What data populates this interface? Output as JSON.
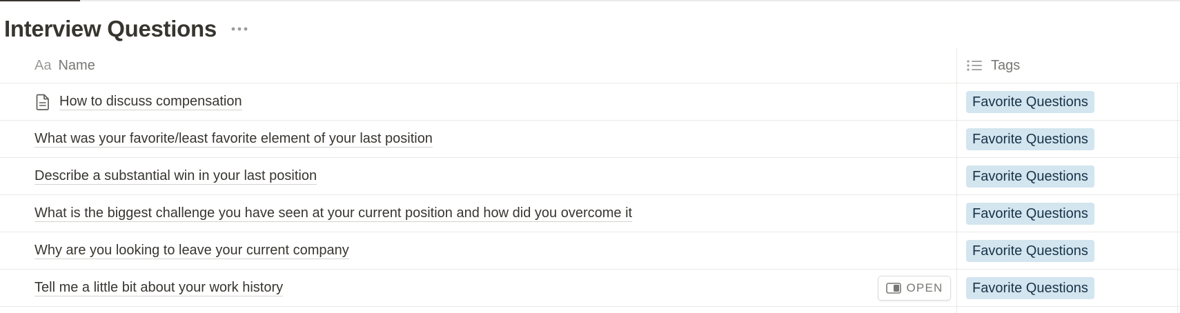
{
  "page": {
    "title": "Interview Questions",
    "more_icon": "ellipsis-icon"
  },
  "columns": {
    "name": {
      "icon": "Aa",
      "label": "Name"
    },
    "tags": {
      "icon": "list-icon",
      "label": "Tags"
    }
  },
  "rows": [
    {
      "name": "How to discuss compensation",
      "tag": "Favorite Questions",
      "icon": "document-icon"
    },
    {
      "name": "What was your favorite/least favorite element of your last position",
      "tag": "Favorite Questions"
    },
    {
      "name": "Describe a substantial win in your last position",
      "tag": "Favorite Questions"
    },
    {
      "name": "What is the biggest challenge you have seen at your current position and how did you overcome it",
      "tag": "Favorite Questions"
    },
    {
      "name": "Why are you looking to leave your current company",
      "tag": "Favorite Questions"
    },
    {
      "name": "Tell me a little bit about your work history",
      "tag": "Favorite Questions"
    }
  ],
  "open_button": {
    "label": "OPEN",
    "icon": "side-peek-icon"
  },
  "colors": {
    "text": "#37352f",
    "muted": "#787774",
    "tag_bg": "#d3e5ef",
    "tag_text": "#183347",
    "border": "#e9e9e7"
  }
}
